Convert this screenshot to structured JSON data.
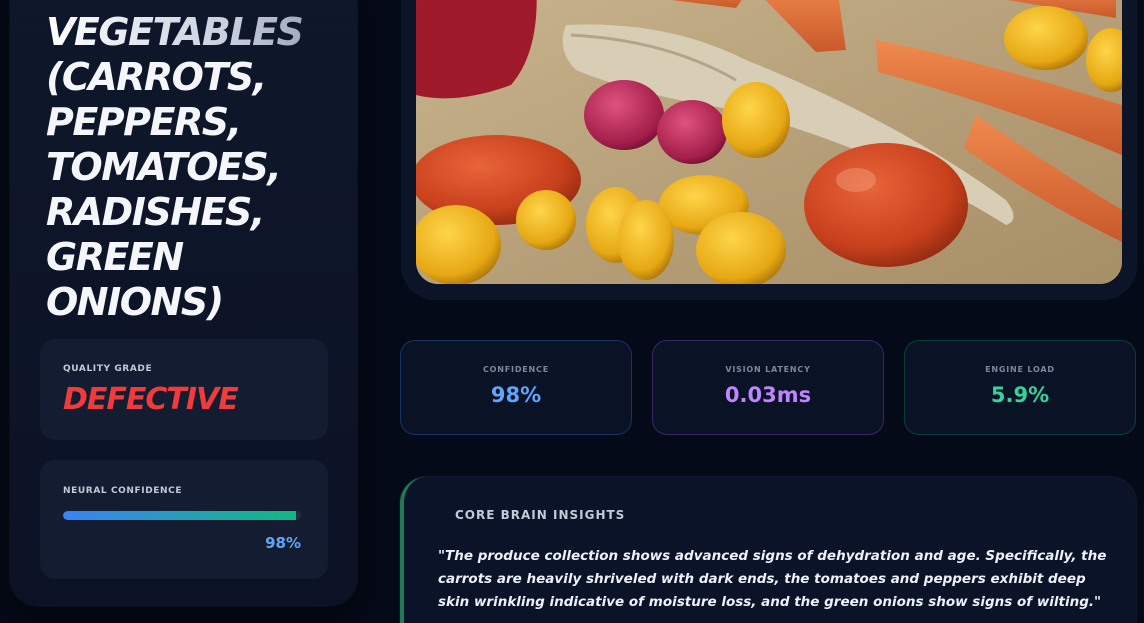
{
  "produce": {
    "title_line1": "VEGETABLES",
    "title_rest": "(CARROTS, PEPPERS, TOMATOES, RADISHES, GREEN ONIONS)"
  },
  "quality": {
    "label": "QUALITY GRADE",
    "grade": "DEFECTIVE",
    "grade_color": "#ef3b3b"
  },
  "neural_confidence": {
    "label": "NEURAL CONFIDENCE",
    "value_text": "98%",
    "fraction": 0.98
  },
  "image": {
    "icon": "produce-photo"
  },
  "stats": {
    "confidence": {
      "label": "CONFIDENCE",
      "value": "98%",
      "color": "#60a5fa"
    },
    "latency": {
      "label": "VISION LATENCY",
      "value": "0.03ms",
      "color": "#c084fc"
    },
    "load": {
      "label": "ENGINE LOAD",
      "value": "5.9%",
      "color": "#34d399"
    }
  },
  "insights": {
    "title": "CORE BRAIN INSIGHTS",
    "quote": "\"The produce collection shows advanced signs of dehydration and age. Specifically, the carrots are heavily shriveled with dark ends, the tomatoes and peppers exhibit deep skin wrinkling indicative of moisture loss, and the green onions show signs of wilting.\""
  },
  "colors": {
    "background": "#050a18",
    "panel": "#0f172b",
    "accent_blue": "#3b82f6",
    "accent_green": "#10b981"
  }
}
